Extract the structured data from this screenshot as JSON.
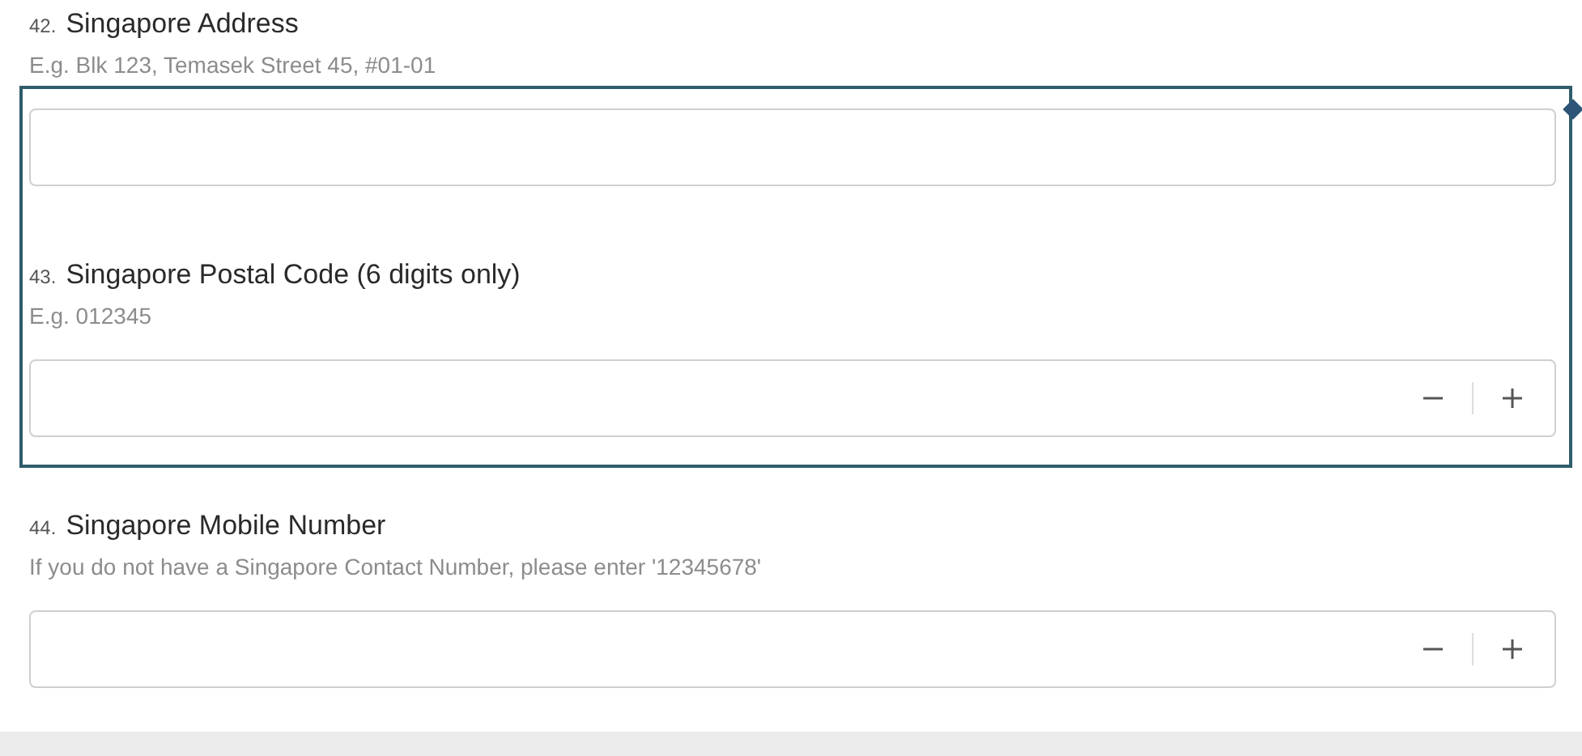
{
  "questions": [
    {
      "number": "42.",
      "title": "Singapore Address",
      "hint": "E.g. Blk 123, Temasek Street 45, #01-01",
      "kind": "text",
      "highlighted": false
    },
    {
      "number": "43.",
      "title": "Singapore Postal Code (6 digits only)",
      "hint": "E.g. 012345",
      "kind": "number",
      "highlighted": true
    },
    {
      "number": "44.",
      "title": "Singapore Mobile Number",
      "hint": "If you do not have a Singapore Contact Number, please enter '12345678'",
      "kind": "number",
      "highlighted": false
    }
  ]
}
